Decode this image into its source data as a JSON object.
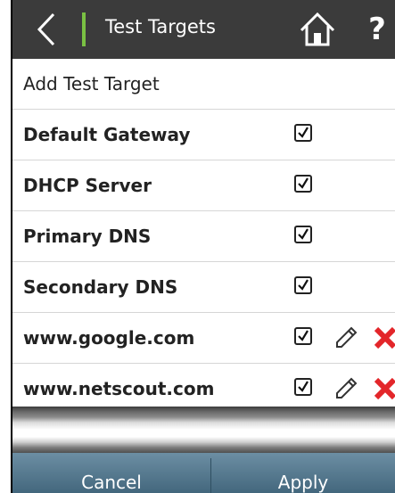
{
  "header": {
    "title": "Test Targets",
    "back_icon": "chevron-left-icon",
    "home_icon": "home-icon",
    "help_label": "?",
    "accent_color": "#7ac143",
    "background_color": "#3b3b3b"
  },
  "add_row": {
    "label": "Add Test Target"
  },
  "targets": [
    {
      "label": "Default Gateway",
      "checked": true,
      "editable": false
    },
    {
      "label": "DHCP Server",
      "checked": true,
      "editable": false
    },
    {
      "label": "Primary DNS",
      "checked": true,
      "editable": false
    },
    {
      "label": "Secondary DNS",
      "checked": true,
      "editable": false
    },
    {
      "label": "www.google.com",
      "checked": true,
      "editable": true
    },
    {
      "label": "www.netscout.com",
      "checked": true,
      "editable": true
    }
  ],
  "footer": {
    "cancel_label": "Cancel",
    "apply_label": "Apply",
    "delete_color": "#e3262a"
  }
}
